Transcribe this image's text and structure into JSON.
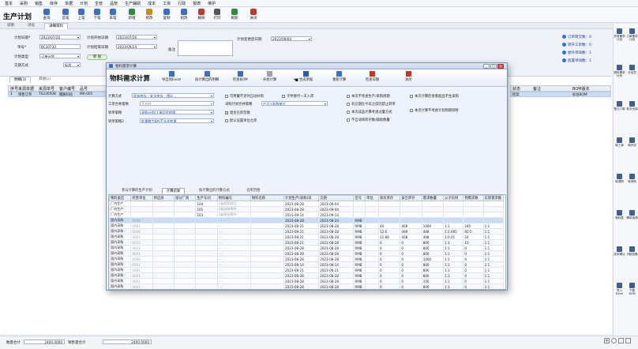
{
  "menu": [
    "基本",
    "采购",
    "销售",
    "库存",
    "单据",
    "计划",
    "生管",
    "品管",
    "生产辅助",
    "成本",
    "工资",
    "行政",
    "报表",
    "维护"
  ],
  "app": {
    "title": "生产计划"
  },
  "toolbar": [
    {
      "label": "查询",
      "color": "#3a6fc4"
    },
    {
      "label": "首笔",
      "color": "#3a6fc4"
    },
    {
      "label": "上笔",
      "color": "#3a6fc4"
    },
    {
      "label": "下笔",
      "color": "#3a6fc4"
    },
    {
      "label": "末笔",
      "color": "#3a6fc4"
    },
    {
      "label": "新增",
      "color": "#2d8a3e"
    },
    {
      "label": "修改",
      "color": "#c98a1a"
    },
    {
      "label": "复制",
      "color": "#3a6fc4"
    },
    {
      "label": "组改",
      "color": "#3a6fc4"
    },
    {
      "label": "删除",
      "color": "#c0392b"
    },
    {
      "label": "打印",
      "color": "#555555"
    },
    {
      "label": "刷新",
      "color": "#2d8a3e"
    },
    {
      "label": "关闭",
      "color": "#c0392b"
    }
  ],
  "tabs": [
    "说明",
    "浏览",
    "详细资料"
  ],
  "form": {
    "plan_date_label": "计划日期*",
    "plan_date": "2023/07/26",
    "doc_no_label": "单号*",
    "doc_no": "BC30730",
    "plan_type_label": "计划类型",
    "plan_type": "订单计划",
    "cost_dept_label": "交期方式",
    "cost_dept": "标准",
    "start_date_label": "计划开始日期",
    "start_date": "2023/07/26",
    "end_date_label": "计划结束日期",
    "end_date": "2023/09/24",
    "remark_label": "备注",
    "change_label": "计划变更后日期",
    "change_date": "2023/09/04",
    "pill": "审 核"
  },
  "status": [
    {
      "label": "订单转交数：0"
    },
    {
      "label": "转开工单数：0"
    },
    {
      "label": "委外单缺数：1"
    },
    {
      "label": "后置单缺数：1"
    }
  ],
  "left_tabs": [
    "明细(1)",
    "其他(c)"
  ],
  "left_header": [
    "序号",
    "来源单据",
    "来源单号",
    "客户编号",
    "品号"
  ],
  "left_row": [
    "1",
    "销售订单",
    "TS230508",
    "腾路科技",
    "MA-001"
  ],
  "right_header": [
    "状态",
    "备注",
    "BOM版本"
  ],
  "right_row": [
    "结案",
    "",
    "标准BOM"
  ],
  "right_sidebar": [
    "多笔需求计划",
    "订单需求计划",
    "物料需求计划",
    "计划员",
    "预占订单",
    "批次出库",
    "转工单",
    "转外协",
    "转请购",
    "转采购",
    "物料表",
    "需求追溯",
    "成本确认",
    "可超准备",
    "导入Excel",
    "下载BOM"
  ],
  "footer": {
    "qty_label": "数量合计",
    "qty": "2400.0000",
    "amount_label": "销售量合计",
    "amount": "2400.0000"
  },
  "dialog": {
    "title": "物料需求计算",
    "heading": "物料需求计算",
    "toolbar": [
      {
        "label": "导出到Excel",
        "color": "#3a6fc4"
      },
      {
        "label": "按计算出的明细",
        "color": "#3a6fc4"
      },
      {
        "label": "检查BOM",
        "color": "#3a6fc4"
      },
      {
        "label": "开始计算",
        "color": "#9aa3ae"
      },
      {
        "label": "生成单据",
        "color": "#2a5cae"
      },
      {
        "label": "重新计算",
        "color": "#3a6fc4"
      },
      {
        "label": "检查日期",
        "color": "#c0392b"
      },
      {
        "label": "关闭",
        "color": "#c0392b"
      }
    ],
    "calc_method_label": "计算方式",
    "calc_method": "现有库存 - 安全库存 - 预计...",
    "wh_label": "工单合并策略",
    "wh_value": "不合并",
    "purchase_label": "采购计划合并策略",
    "purchase_value": "产品+采购单位",
    "convert_label": "转单策略",
    "convert_value": "采购计划/工单同步转换",
    "convert2_label": "转单策略2",
    "convert2_value": "批量数为0的不允许转换",
    "checks": [
      {
        "label": "可用量不足时自动补购",
        "on": false
      },
      {
        "label": "子件替代一天入库",
        "on": false
      },
      {
        "label": "现金在库型数",
        "on": true
      },
      {
        "label": "默认设置单位仓库",
        "on": false
      },
      {
        "label": "本次不考虑生产/采购周期",
        "on": false
      },
      {
        "label": "有交期在今日之前的禁止转单",
        "on": false
      },
      {
        "label": "本次成品计算考虑过量方式",
        "on": false
      },
      {
        "label": "不自动转库存数/辅助数量",
        "on": false
      },
      {
        "label": "本次计算后查看配品不生采购",
        "on": false
      },
      {
        "label": "本次计算不考虑计划到期转移",
        "on": false
      }
    ],
    "subtabs": [
      "参与计算的生产计划",
      "计算结果",
      "按计算出的计算方式",
      "仓库范围"
    ],
    "columns": [
      "物料类型",
      "经营单位",
      "供应商",
      "部分厂商",
      "生产车间",
      "物料编号",
      "物料名称",
      "计划生产(采购)日",
      "交期",
      "型号",
      "单位",
      "现有库存",
      "安全库存",
      "需求数量",
      "父子比例",
      "预需求数",
      "实际需求数"
    ],
    "rows": [
      [
        "厂内生产",
        "",
        "",
        "",
        "104",
        "1级装配成品",
        "2023-08-28",
        "2023-09-04",
        "",
        "",
        "",
        "",
        "",
        "",
        "",
        ""
      ],
      [
        "厂内生产",
        "",
        "",
        "",
        "101",
        "1级部装零件",
        "2023-08-28",
        "2023-09-04",
        "",
        "",
        "",
        "",
        "",
        "",
        "",
        ""
      ],
      [
        "厂内生产",
        "",
        "",
        "",
        "103",
        "1级装配零件",
        "2023-09-14",
        "2023-09-14",
        "",
        "",
        "",
        "",
        "",
        "",
        "",
        ""
      ],
      [
        "国内采购",
        "0004",
        "",
        "",
        "",
        "---",
        "2023-08-28",
        "2023-08-24",
        "RMB",
        "",
        "",
        "",
        "",
        "",
        "",
        ""
      ],
      [
        "国内采购",
        "0001",
        "",
        "",
        "",
        "---",
        "2023-08-21",
        "2023-08-28",
        "RMB",
        "40",
        "408",
        "1000",
        "1:1",
        "240",
        "1:1",
        "100"
      ],
      [
        "国内采购",
        "0008",
        "",
        "",
        "",
        "---",
        "2023-08-21",
        "2023-08-28",
        "RMB",
        "12.6",
        "409",
        "408",
        "1:1.005",
        "60.5",
        "1:1",
        "58"
      ],
      [
        "国内采购",
        "0003",
        "",
        "",
        "",
        "---",
        "2023-08-21",
        "2023-08-28",
        "RMB",
        "11.89",
        "408",
        "408",
        "1:0.01",
        "24",
        "1:1",
        "36"
      ],
      [
        "国内采购",
        "0015",
        "",
        "",
        "",
        "---",
        "2023-08-21",
        "2023-08-28",
        "RMB",
        "0",
        "0",
        "800",
        "1:1",
        "10",
        "1:1",
        "10"
      ],
      [
        "国内采购",
        "0012",
        "",
        "",
        "",
        "---",
        "2023-08-28",
        "2023-08-28",
        "RMB",
        "0",
        "0",
        "800",
        "1:1",
        "0",
        "1:1",
        "0"
      ],
      [
        "国内采购",
        "0001",
        "",
        "",
        "",
        "---",
        "2023-08-28",
        "2023-08-28",
        "RMB",
        "0",
        "0",
        "800",
        "1:1",
        "0",
        "1:1",
        "0"
      ],
      [
        "国内采购",
        "0009",
        "",
        "",
        "",
        "---",
        "2023-08-28",
        "2023-08-28",
        "RMB",
        "0",
        "0",
        "1000",
        "1:1",
        "0",
        "1:1",
        "0"
      ],
      [
        "国内采购",
        "0001",
        "",
        "",
        "",
        "---",
        "2023-08-14",
        "2023-08-14",
        "RMB",
        "0",
        "0",
        "800",
        "1:1",
        "0",
        "1:1",
        "0"
      ],
      [
        "国内采购",
        "0001",
        "",
        "",
        "",
        "---",
        "2023-08-21",
        "2023-08-21",
        "RMB",
        "0",
        "0",
        "800",
        "1:1",
        "0",
        "1:1",
        "0"
      ],
      [
        "国内采购",
        "0001",
        "",
        "",
        "",
        "---",
        "2023-08-28",
        "2023-08-28",
        "RMB",
        "0",
        "0",
        "800",
        "1:1",
        "0",
        "1:1",
        "0"
      ],
      [
        "国内采购",
        "0001",
        "",
        "",
        "",
        "---",
        "2023-08-28",
        "2023-08-28",
        "RMB",
        "0",
        "0",
        "100",
        "1:1",
        "0",
        "1:1",
        "0"
      ],
      [
        "国内采购",
        "0001",
        "",
        "",
        "",
        "---",
        "2023-08-28",
        "2023-08-28",
        "RMB",
        "0",
        "0",
        "800",
        "1:1",
        "0",
        "1:1",
        "0"
      ],
      [
        "国内采购",
        "0001",
        "",
        "",
        "",
        "---",
        "2023-08-28",
        "2023-08-28",
        "RMB",
        "0",
        "0",
        "800",
        "1:1",
        "0",
        "1:1",
        "0"
      ],
      [
        "国内采购",
        "0001",
        "",
        "",
        "",
        "---",
        "2023-08-28",
        "2023-08-28",
        "RMB",
        "0",
        "0",
        "100",
        "1:1",
        "0",
        "1:1",
        "0"
      ]
    ]
  }
}
